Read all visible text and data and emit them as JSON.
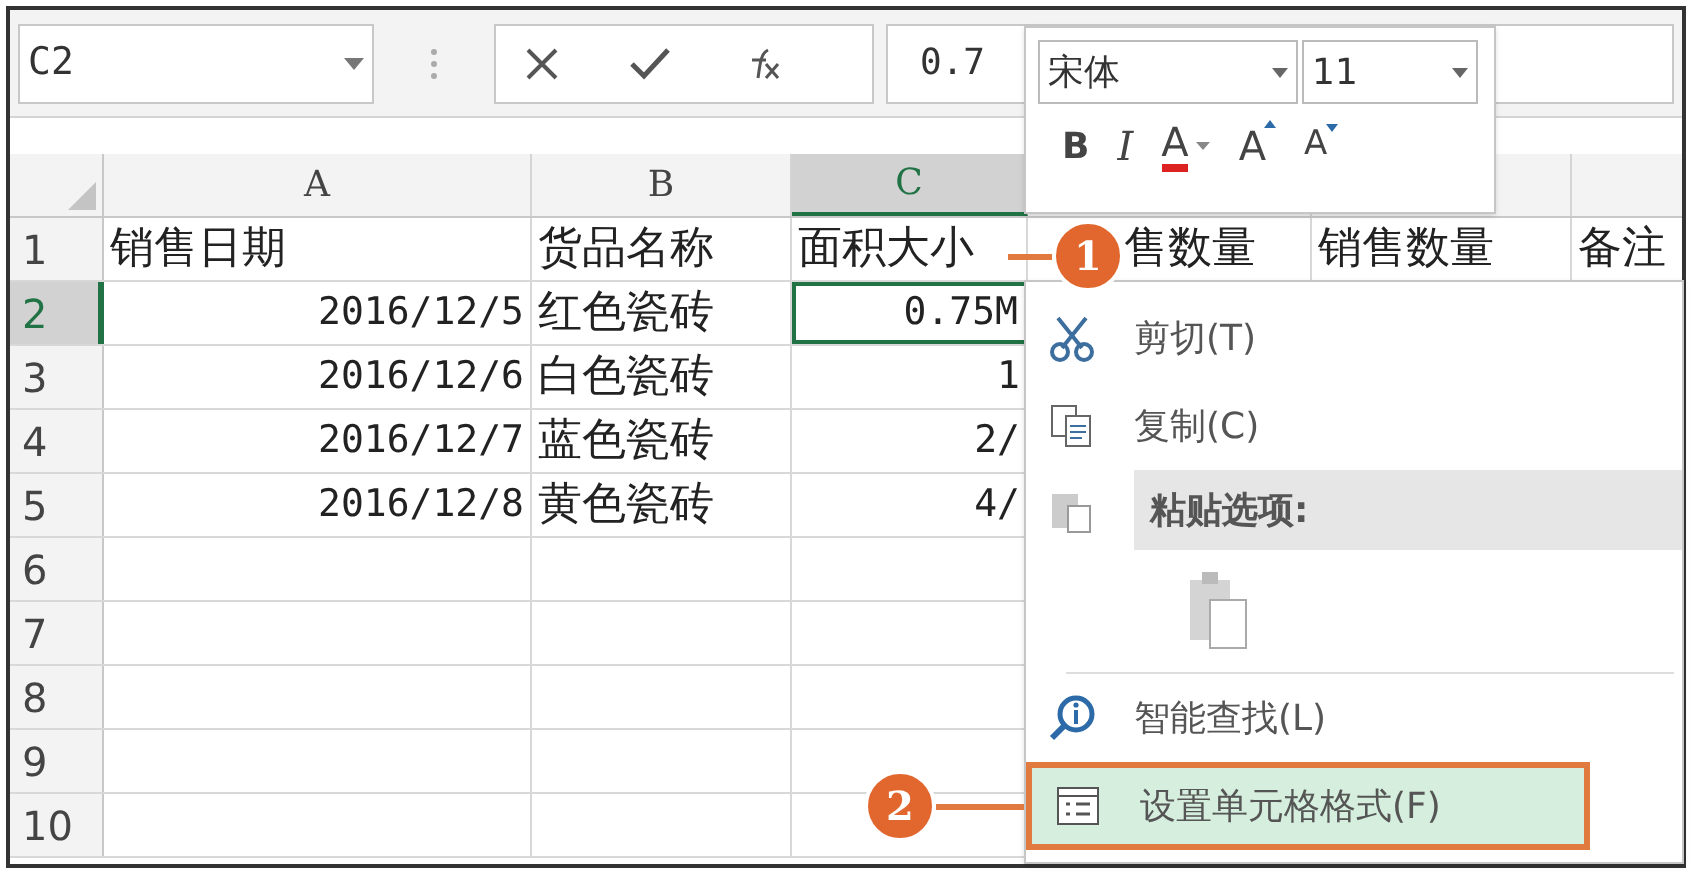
{
  "formula_bar": {
    "name_box": "C2",
    "formula": "0.7"
  },
  "columns": [
    {
      "label": "A",
      "selected": false
    },
    {
      "label": "B",
      "selected": false
    },
    {
      "label": "C",
      "selected": true
    }
  ],
  "rows": [
    {
      "header": "1",
      "selected": false,
      "cells": [
        "销售日期",
        "货品名称",
        "面积大小",
        "售数量",
        "销售数量",
        "备注"
      ]
    },
    {
      "header": "2",
      "selected": true,
      "cells": [
        "2016/12/5",
        "红色瓷砖",
        "0.75M"
      ]
    },
    {
      "header": "3",
      "selected": false,
      "cells": [
        "2016/12/6",
        "白色瓷砖",
        "1"
      ]
    },
    {
      "header": "4",
      "selected": false,
      "cells": [
        "2016/12/7",
        "蓝色瓷砖",
        "2/"
      ]
    },
    {
      "header": "5",
      "selected": false,
      "cells": [
        "2016/12/8",
        "黄色瓷砖",
        "4/"
      ]
    },
    {
      "header": "6",
      "selected": false,
      "cells": []
    },
    {
      "header": "7",
      "selected": false,
      "cells": []
    },
    {
      "header": "8",
      "selected": false,
      "cells": []
    },
    {
      "header": "9",
      "selected": false,
      "cells": []
    },
    {
      "header": "10",
      "selected": false,
      "cells": []
    }
  ],
  "mini_toolbar": {
    "font": "宋体",
    "size": "11",
    "bold": "B",
    "italic": "I",
    "font_color": "A",
    "grow": "A",
    "shrink": "A"
  },
  "menu": [
    {
      "kind": "item",
      "label": "剪切(T)",
      "selected": false
    },
    {
      "kind": "item",
      "label": "复制(C)",
      "selected": false
    },
    {
      "kind": "header",
      "label": "粘贴选项:"
    },
    {
      "kind": "paste_icons"
    },
    {
      "kind": "item",
      "label": "智能查找(L)",
      "selected": false
    },
    {
      "kind": "item",
      "label": "设置单元格格式(F)",
      "selected": true
    }
  ],
  "callouts": [
    "1",
    "2"
  ]
}
